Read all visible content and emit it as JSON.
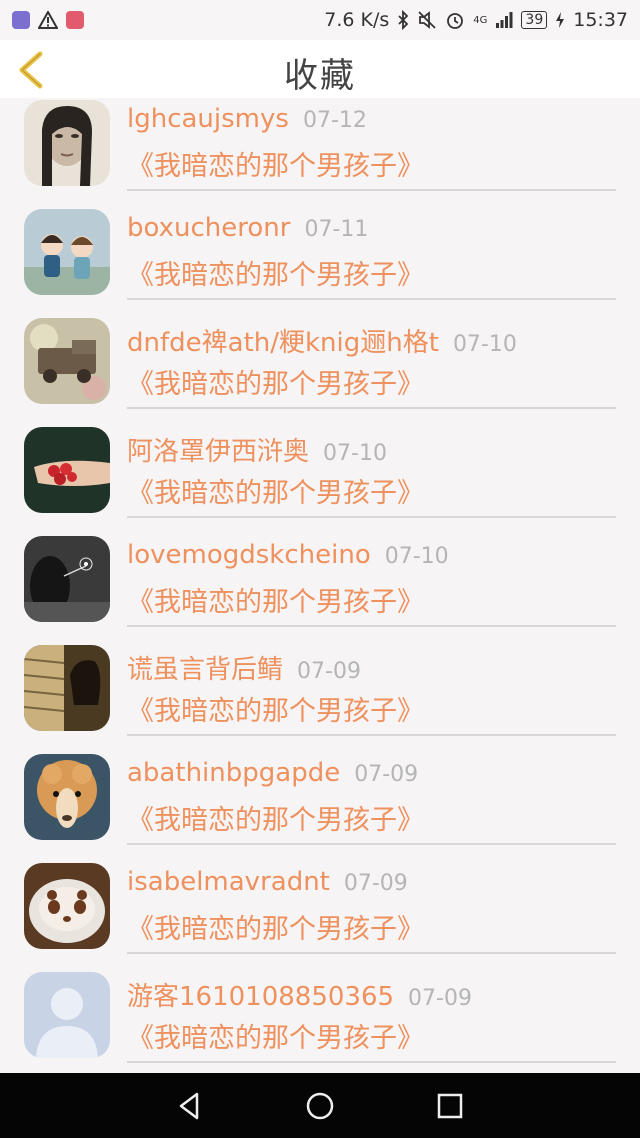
{
  "status_bar": {
    "speed": "7.6 K/s",
    "network": "4G",
    "battery": "39",
    "time": "15:37",
    "icons": [
      "app-icon-purple",
      "warning-icon",
      "app-icon-red",
      "bluetooth-icon",
      "battery-icon",
      "mute-icon",
      "alarm-icon",
      "signal-icon",
      "charging-icon"
    ]
  },
  "header": {
    "title": "收藏",
    "back_icon": "chevron-left-icon",
    "accent_color": "#e8c043"
  },
  "items": [
    {
      "name": "lghcaujsmys",
      "date": "07-12",
      "book": "《我暗恋的那个男孩子》",
      "avatar": "portrait-woman"
    },
    {
      "name": "boxucheronr",
      "date": "07-11",
      "book": "《我暗恋的那个男孩子》",
      "avatar": "cartoon-kids"
    },
    {
      "name": "dnfde禆ath/粳knig逦h格t",
      "date": "07-10",
      "book": "《我暗恋的那个男孩子》",
      "avatar": "vintage-truck"
    },
    {
      "name": "阿洛罩伊西浒奥",
      "date": "07-10",
      "book": "《我暗恋的那个男孩子》",
      "avatar": "hands-strawberries"
    },
    {
      "name": "lovemogdskcheino",
      "date": "07-10",
      "book": "《我暗恋的那个男孩子》",
      "avatar": "bw-dandelion"
    },
    {
      "name": "谎虽言背后鲭",
      "date": "07-09",
      "book": "《我暗恋的那个男孩子》",
      "avatar": "girl-window"
    },
    {
      "name": "abathinbpgapde",
      "date": "07-09",
      "book": "《我暗恋的那个男孩子》",
      "avatar": "alpaca"
    },
    {
      "name": "isabelmavradnt",
      "date": "07-09",
      "book": "《我暗恋的那个男孩子》",
      "avatar": "panda-latte"
    },
    {
      "name": "游客1610108850365",
      "date": "07-09",
      "book": "《我暗恋的那个男孩子》",
      "avatar": "default-user"
    }
  ],
  "nav_bar": {
    "buttons": [
      "back-triangle-icon",
      "home-circle-icon",
      "recents-square-icon"
    ]
  }
}
